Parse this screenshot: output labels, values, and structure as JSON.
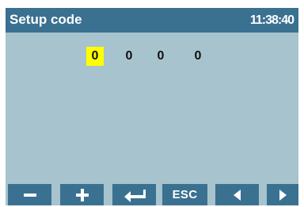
{
  "header": {
    "title": "Setup code",
    "time": "11:38:40"
  },
  "code": {
    "digits": [
      "0",
      "0",
      "0",
      "0"
    ],
    "selected_index": 0
  },
  "buttons": [
    {
      "icon": "minus-icon"
    },
    {
      "icon": "plus-icon"
    },
    {
      "icon": "enter-icon"
    },
    {
      "label": "ESC"
    },
    {
      "icon": "left-arrow-icon"
    },
    {
      "icon": "right-arrow-icon"
    }
  ],
  "colors": {
    "title_bar": "#3a7191",
    "background": "#a7c3ce",
    "selection": "#ffff00",
    "text_light": "#ffffff",
    "text_dark": "#111111"
  }
}
